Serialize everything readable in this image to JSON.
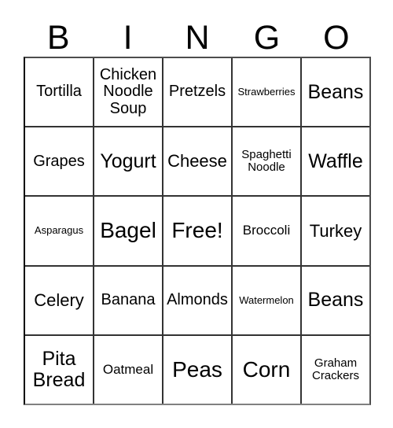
{
  "card": {
    "title": "BINGO",
    "header_letters": [
      "B",
      "I",
      "N",
      "G",
      "O"
    ],
    "free_space_label": "Free!",
    "grid": {
      "columns": 5,
      "rows": 5,
      "cells": [
        [
          {
            "label": "Tortilla",
            "size": "lg"
          },
          {
            "label": "Chicken Noodle Soup",
            "size": "lg"
          },
          {
            "label": "Pretzels",
            "size": "lg"
          },
          {
            "label": "Strawberries",
            "size": "xs"
          },
          {
            "label": "Beans",
            "size": "xxl"
          }
        ],
        [
          {
            "label": "Grapes",
            "size": "lg"
          },
          {
            "label": "Yogurt",
            "size": "xxl"
          },
          {
            "label": "Cheese",
            "size": "xl"
          },
          {
            "label": "Spaghetti Noodle",
            "size": "sm"
          },
          {
            "label": "Waffle",
            "size": "xxl"
          }
        ],
        [
          {
            "label": "Asparagus",
            "size": "xs"
          },
          {
            "label": "Bagel",
            "size": "huge"
          },
          {
            "label": "Free!",
            "size": "huge"
          },
          {
            "label": "Broccoli",
            "size": "md"
          },
          {
            "label": "Turkey",
            "size": "xl"
          }
        ],
        [
          {
            "label": "Celery",
            "size": "xl"
          },
          {
            "label": "Banana",
            "size": "lg"
          },
          {
            "label": "Almonds",
            "size": "lg"
          },
          {
            "label": "Watermelon",
            "size": "xs"
          },
          {
            "label": "Beans",
            "size": "xxl"
          }
        ],
        [
          {
            "label": "Pita Bread",
            "size": "xxl"
          },
          {
            "label": "Oatmeal",
            "size": "md"
          },
          {
            "label": "Peas",
            "size": "huge"
          },
          {
            "label": "Corn",
            "size": "huge"
          },
          {
            "label": "Graham Crackers",
            "size": "sm"
          }
        ]
      ]
    }
  },
  "colors": {
    "background": "#ffffff",
    "text": "#000000",
    "grid_line": "#333333",
    "grid_border": "#000000"
  }
}
